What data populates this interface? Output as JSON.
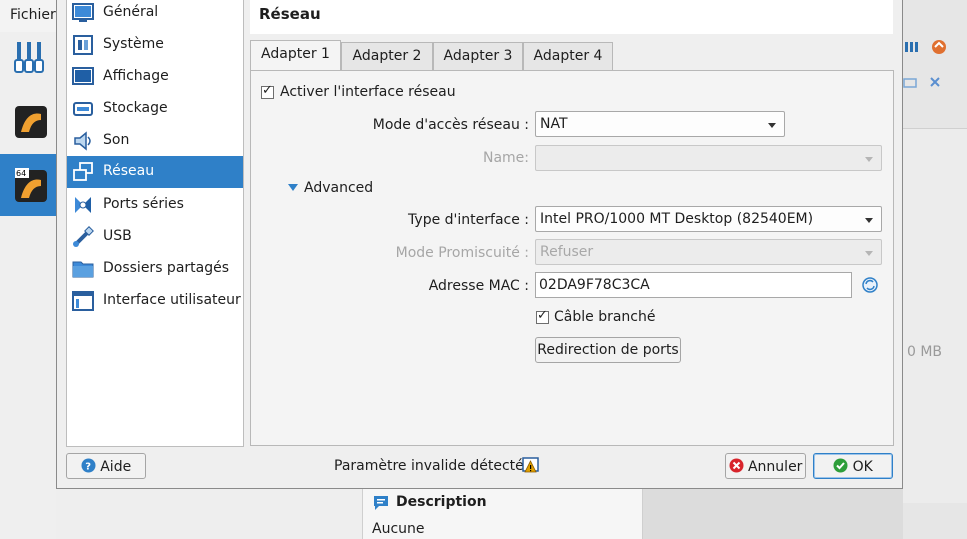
{
  "background": {
    "menu_item": "Fichier",
    "size_fragment": "0 MB",
    "description_title": "Description",
    "description_value": "Aucune"
  },
  "dialog": {
    "page_title": "Réseau",
    "sidebar": [
      {
        "label": "Général",
        "icon": "monitor-icon"
      },
      {
        "label": "Système",
        "icon": "chip-icon"
      },
      {
        "label": "Affichage",
        "icon": "display-icon"
      },
      {
        "label": "Stockage",
        "icon": "storage-icon"
      },
      {
        "label": "Son",
        "icon": "speaker-icon"
      },
      {
        "label": "Réseau",
        "icon": "network-icon",
        "selected": true
      },
      {
        "label": "Ports séries",
        "icon": "serial-port-icon"
      },
      {
        "label": "USB",
        "icon": "usb-icon"
      },
      {
        "label": "Dossiers partagés",
        "icon": "folder-icon"
      },
      {
        "label": "Interface utilisateur",
        "icon": "ui-window-icon"
      }
    ],
    "tabs": [
      "Adapter 1",
      "Adapter 2",
      "Adapter 3",
      "Adapter 4"
    ],
    "active_tab": 0,
    "enable_adapter": {
      "label": "Activer l'interface réseau",
      "checked": true
    },
    "attached_to": {
      "label": "Mode d'accès réseau :",
      "value": "NAT"
    },
    "name": {
      "label": "Name:",
      "value": ""
    },
    "advanced": {
      "label": "Advanced"
    },
    "adapter_type": {
      "label": "Type d'interface :",
      "value": "Intel PRO/1000 MT Desktop (82540EM)"
    },
    "promiscuous": {
      "label": "Mode Promiscuité :",
      "value": "Refuser"
    },
    "mac": {
      "label": "Adresse MAC :",
      "value": "02DA9F78C3CA"
    },
    "cable": {
      "label": "Câble branché",
      "checked": true
    },
    "port_forwarding": "Redirection de ports",
    "help_button": "Aide",
    "status_text": "Paramètre invalide détecté",
    "cancel_button": "Annuler",
    "ok_button": "OK"
  },
  "colors": {
    "selection": "#2f80c8",
    "warning": "#e0a000"
  }
}
